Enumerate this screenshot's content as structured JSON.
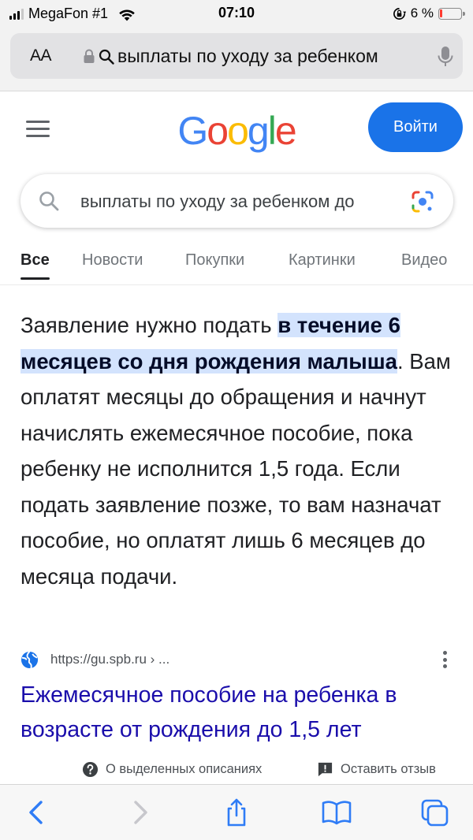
{
  "status_bar": {
    "carrier": "MegaFon #1",
    "time": "07:10",
    "battery_text": "6 %",
    "battery_level_percent": 6
  },
  "address_bar": {
    "aa_label": "AA",
    "url_text": "выплаты по уходу за ребенком"
  },
  "header": {
    "logo_letters": [
      "G",
      "o",
      "o",
      "g",
      "l",
      "e"
    ],
    "signin_label": "Войти"
  },
  "search": {
    "query": "выплаты по уходу за ребенком до"
  },
  "tabs": [
    {
      "label": "Все",
      "active": true
    },
    {
      "label": "Новости",
      "active": false
    },
    {
      "label": "Покупки",
      "active": false
    },
    {
      "label": "Картинки",
      "active": false
    },
    {
      "label": "Видео",
      "active": false
    }
  ],
  "snippet": {
    "before": "Заявление нужно подать ",
    "highlight": "в течение 6 месяцев со дня рождения малыша",
    "after": ". Вам оплатят месяцы до обращения и начнут начислять ежемесячное пособие, пока ребенку не исполнится 1,5 года. Если подать заявление позже, то вам назначат пособие, но оплатят лишь 6 месяцев до месяца подачи."
  },
  "result": {
    "url": "https://gu.spb.ru › ...",
    "title": "Ежемесячное пособие на ребенка в возрасте от рождения до 1,5 лет"
  },
  "footer_links": {
    "about": "О выделенных описаниях",
    "feedback": "Оставить отзыв"
  },
  "colors": {
    "accent_blue": "#1a73e8",
    "link_blue": "#1a0dab",
    "highlight_bg": "#d3e3fd",
    "safari_blue": "#2f7cf6"
  }
}
